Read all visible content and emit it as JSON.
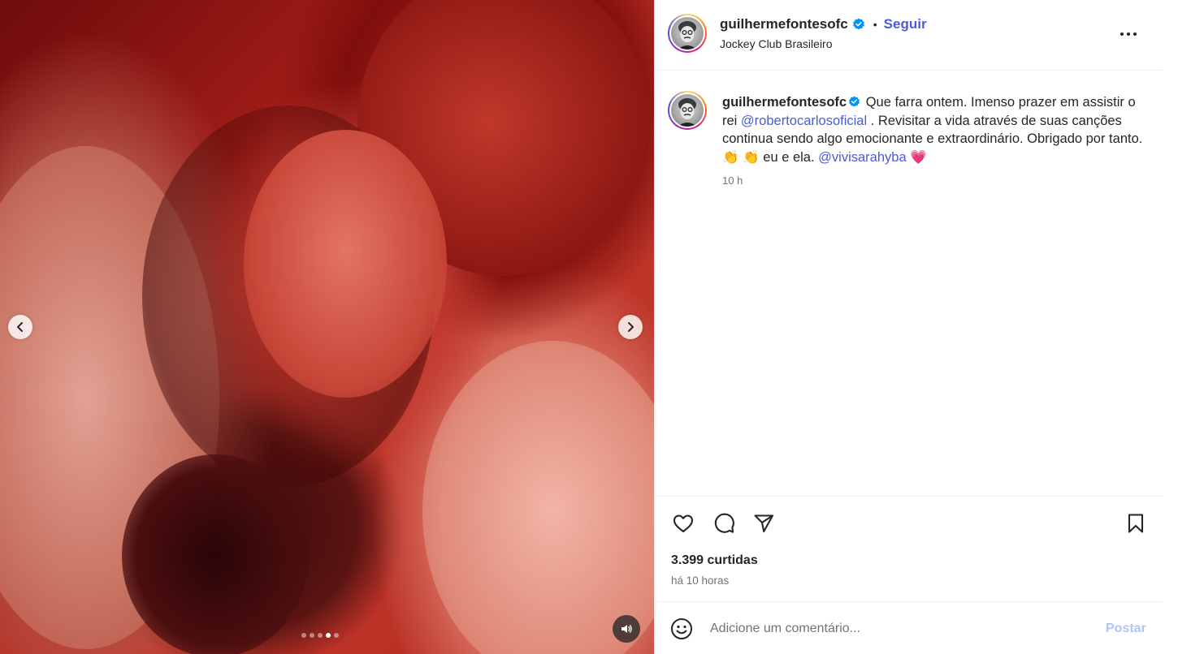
{
  "post": {
    "username": "guilhermefontesofc",
    "verified_icon": "verified-badge-icon",
    "separator": "•",
    "follow_label": "Seguir",
    "location": "Jockey Club Brasileiro",
    "more_icon": "more-options-icon"
  },
  "caption": {
    "username": "guilhermefontesofc",
    "text_1": " Que farra ontem. Imenso prazer em assistir o rei ",
    "mention_1": "@robertocarlosoficial",
    "text_2": " . Revisitar a vida através de suas canções continua sendo algo emocionante e extraordinário. Obrigado por tanto. ",
    "emoji_1": "👏",
    "emoji_2": "👏",
    "text_3": " eu e ela. ",
    "mention_2": "@vivisarahyba",
    "emoji_3": "💗",
    "time": "10 h"
  },
  "carousel": {
    "slide_count": 5,
    "active_index": 3
  },
  "engagement": {
    "likes": "3.399 curtidas",
    "time_ago": "há 10 horas"
  },
  "comment": {
    "placeholder": "Adicione um comentário...",
    "post_label": "Postar"
  },
  "colors": {
    "link": "#4a5bd8",
    "post_disabled": "#b2c3f6",
    "verified": "#0095f6"
  }
}
